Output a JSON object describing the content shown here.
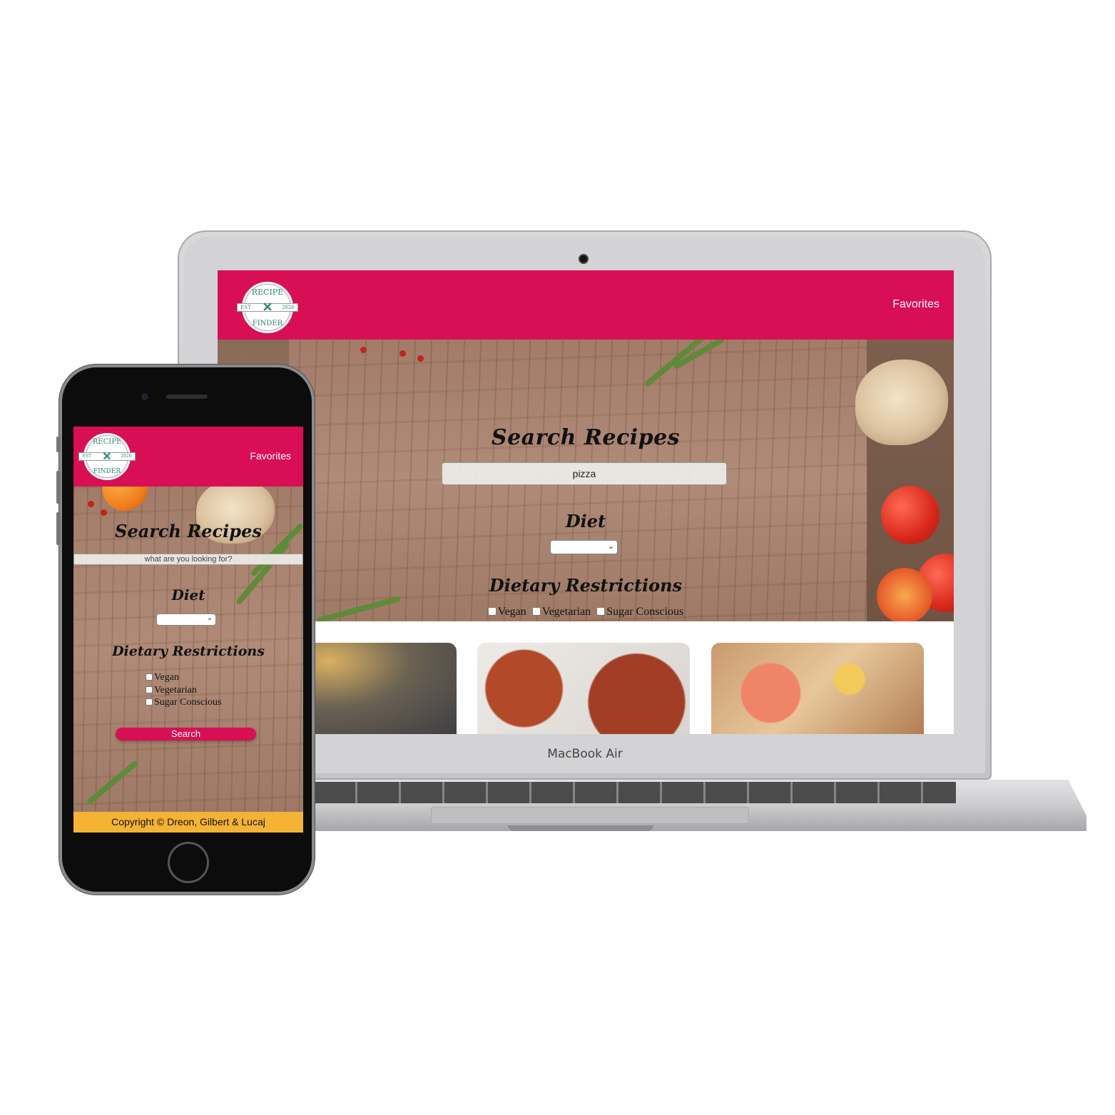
{
  "brand": {
    "accent_color": "#d80f55",
    "footer_color": "#f5b335",
    "logo": {
      "top": "RECIPE",
      "bottom": "FINDER",
      "est": "EST",
      "year": "2020"
    }
  },
  "header": {
    "favorites_label": "Favorites"
  },
  "search": {
    "title": "Search Recipes",
    "laptop_query": "pizza",
    "placeholder": "what are you looking for?",
    "button_label": "Search"
  },
  "diet": {
    "label": "Diet",
    "selected": ""
  },
  "restrictions": {
    "label": "Dietary Restrictions",
    "options": [
      "Vegan",
      "Vegetarian",
      "Sugar Conscious"
    ]
  },
  "device": {
    "laptop_brand": "MacBook Air"
  },
  "footer": {
    "copyright": "Copyright © Dreon, Gilbert & Lucaj"
  }
}
